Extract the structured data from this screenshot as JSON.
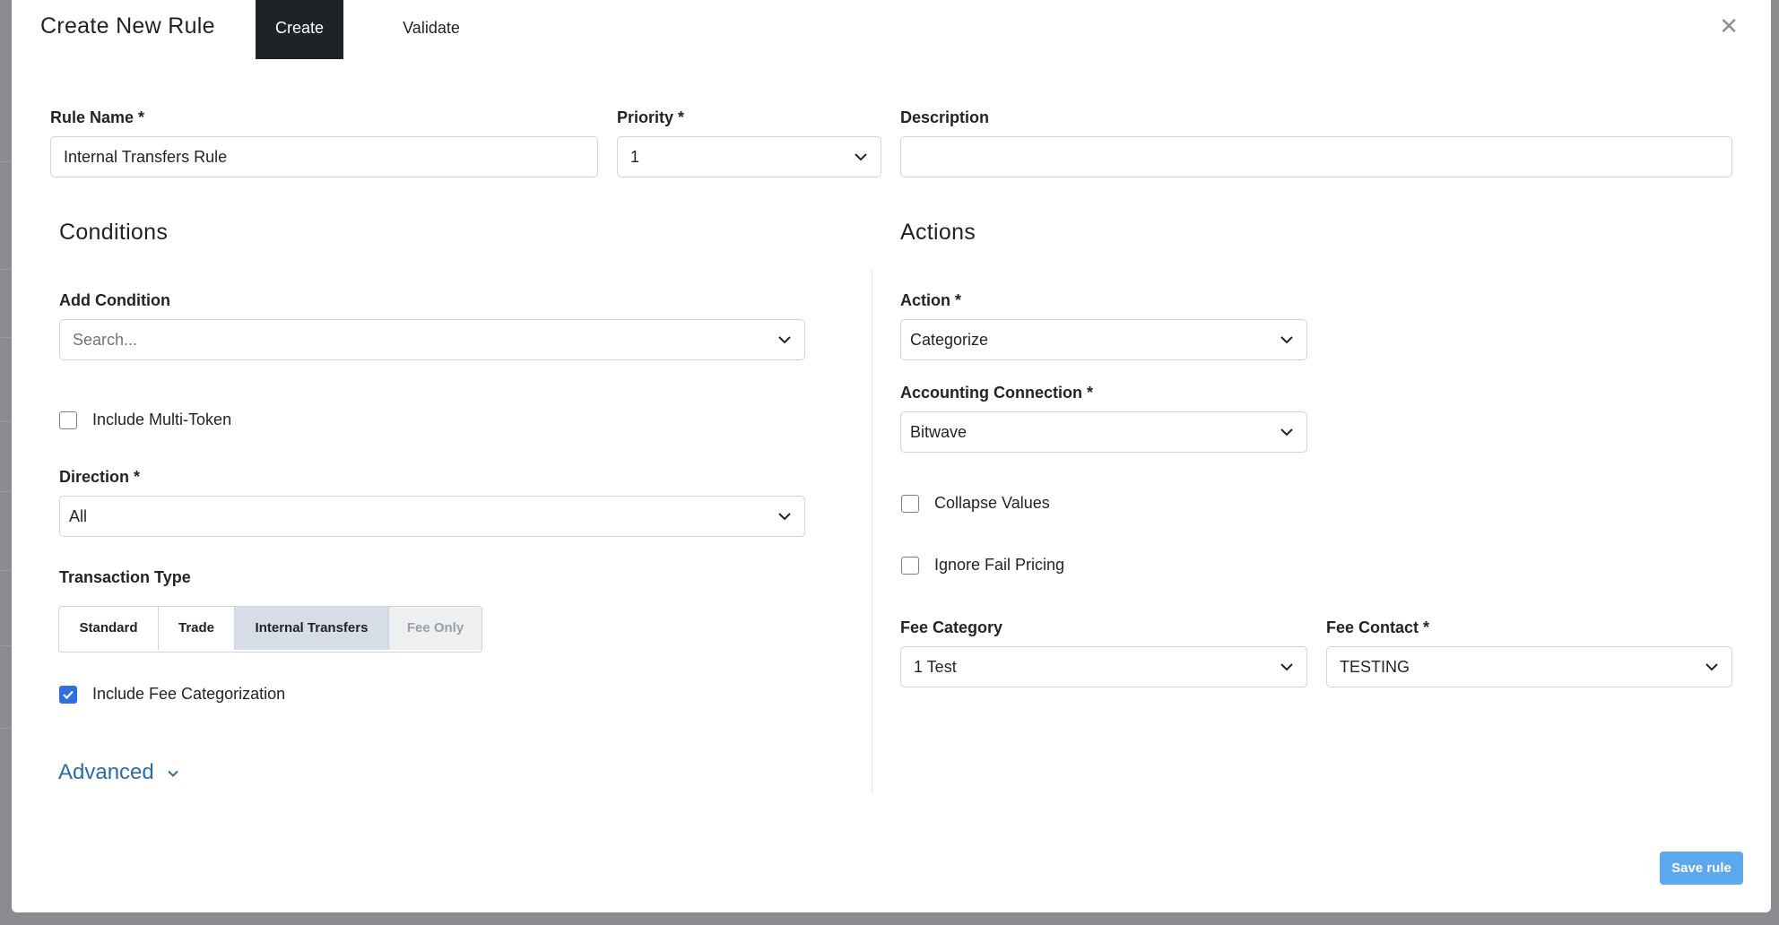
{
  "modal": {
    "title": "Create New Rule",
    "tabs": [
      {
        "label": "Create",
        "active": true
      },
      {
        "label": "Validate",
        "active": false
      }
    ],
    "close_icon": "close-icon"
  },
  "rule_name": {
    "label": "Rule Name *",
    "value": "Internal Transfers Rule"
  },
  "priority": {
    "label": "Priority *",
    "value": "1"
  },
  "description": {
    "label": "Description",
    "value": ""
  },
  "conditions": {
    "heading": "Conditions",
    "add_condition": {
      "label": "Add Condition",
      "placeholder": "Search..."
    },
    "include_multi_token": {
      "label": "Include Multi-Token",
      "checked": false
    },
    "direction": {
      "label": "Direction *",
      "value": "All"
    },
    "transaction_type": {
      "label": "Transaction Type",
      "options": [
        {
          "label": "Standard",
          "state": "default"
        },
        {
          "label": "Trade",
          "state": "default"
        },
        {
          "label": "Internal Transfers",
          "state": "selected"
        },
        {
          "label": "Fee Only",
          "state": "disabled"
        }
      ]
    },
    "include_fee_categorization": {
      "label": "Include Fee Categorization",
      "checked": true
    },
    "advanced": "Advanced"
  },
  "actions": {
    "heading": "Actions",
    "action": {
      "label": "Action *",
      "value": "Categorize"
    },
    "accounting_connection": {
      "label": "Accounting Connection *",
      "value": "Bitwave"
    },
    "collapse_values": {
      "label": "Collapse Values",
      "checked": false
    },
    "ignore_fail_pricing": {
      "label": "Ignore Fail Pricing",
      "checked": false
    },
    "fee_category": {
      "label": "Fee Category",
      "value": "1 Test"
    },
    "fee_contact": {
      "label": "Fee Contact *",
      "value": "TESTING"
    }
  },
  "footer": {
    "save_label": "Save rule"
  },
  "colors": {
    "active_tab_bg": "#1f2326",
    "checkbox_checked": "#2f6fe0",
    "link": "#2e6aa8",
    "save_button": "#5ba8ef",
    "segment_selected": "#d6dde6"
  }
}
